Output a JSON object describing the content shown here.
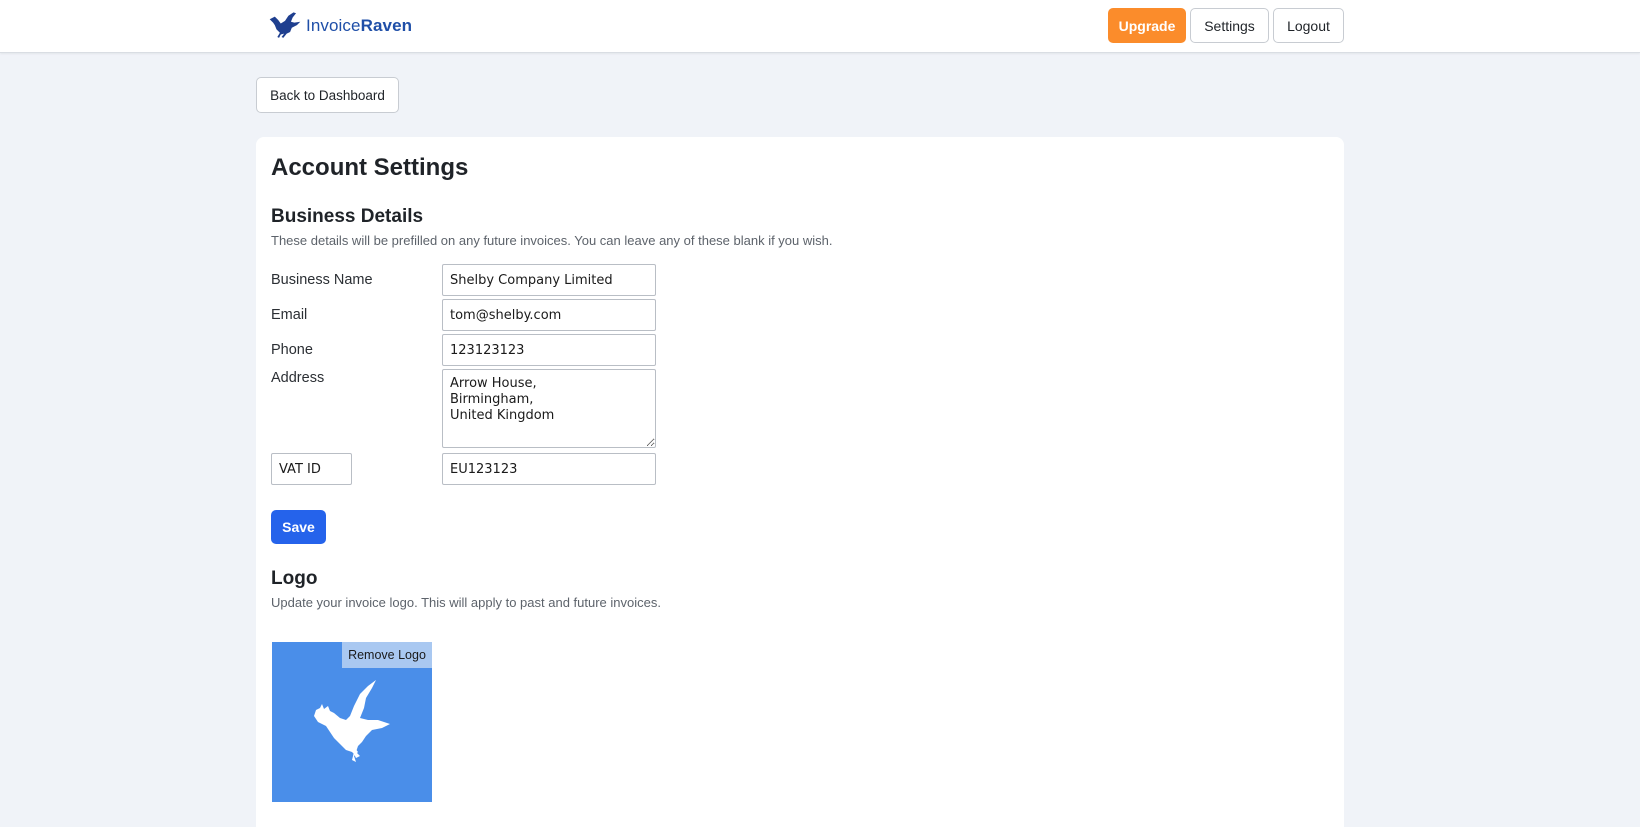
{
  "header": {
    "brand": {
      "name_prefix": "Invoice",
      "name_suffix": "Raven",
      "icon": "raven-logo-icon"
    },
    "nav": {
      "upgrade_label": "Upgrade",
      "settings_label": "Settings",
      "logout_label": "Logout"
    }
  },
  "back_button_label": "Back to Dashboard",
  "page_title": "Account Settings",
  "business": {
    "title": "Business Details",
    "description": "These details will be prefilled on any future invoices. You can leave any of these blank if you wish.",
    "fields": {
      "business_name": {
        "label": "Business Name",
        "value": "Shelby Company Limited"
      },
      "email": {
        "label": "Email",
        "value": "tom@shelby.com"
      },
      "phone": {
        "label": "Phone",
        "value": "123123123"
      },
      "address": {
        "label": "Address",
        "value": "Arrow House,\nBirmingham,\nUnited Kingdom"
      },
      "tax_id": {
        "label_value": "VAT ID",
        "value": "EU123123"
      }
    },
    "save_label": "Save"
  },
  "logo": {
    "title": "Logo",
    "description": "Update your invoice logo. This will apply to past and future invoices.",
    "remove_label": "Remove Logo",
    "icon": "raven-silhouette-icon"
  },
  "colors": {
    "brand_blue": "#1f4fa8",
    "upgrade_orange": "#fb8c2b",
    "save_blue": "#2563eb",
    "logo_bg": "#4a8ee9"
  }
}
